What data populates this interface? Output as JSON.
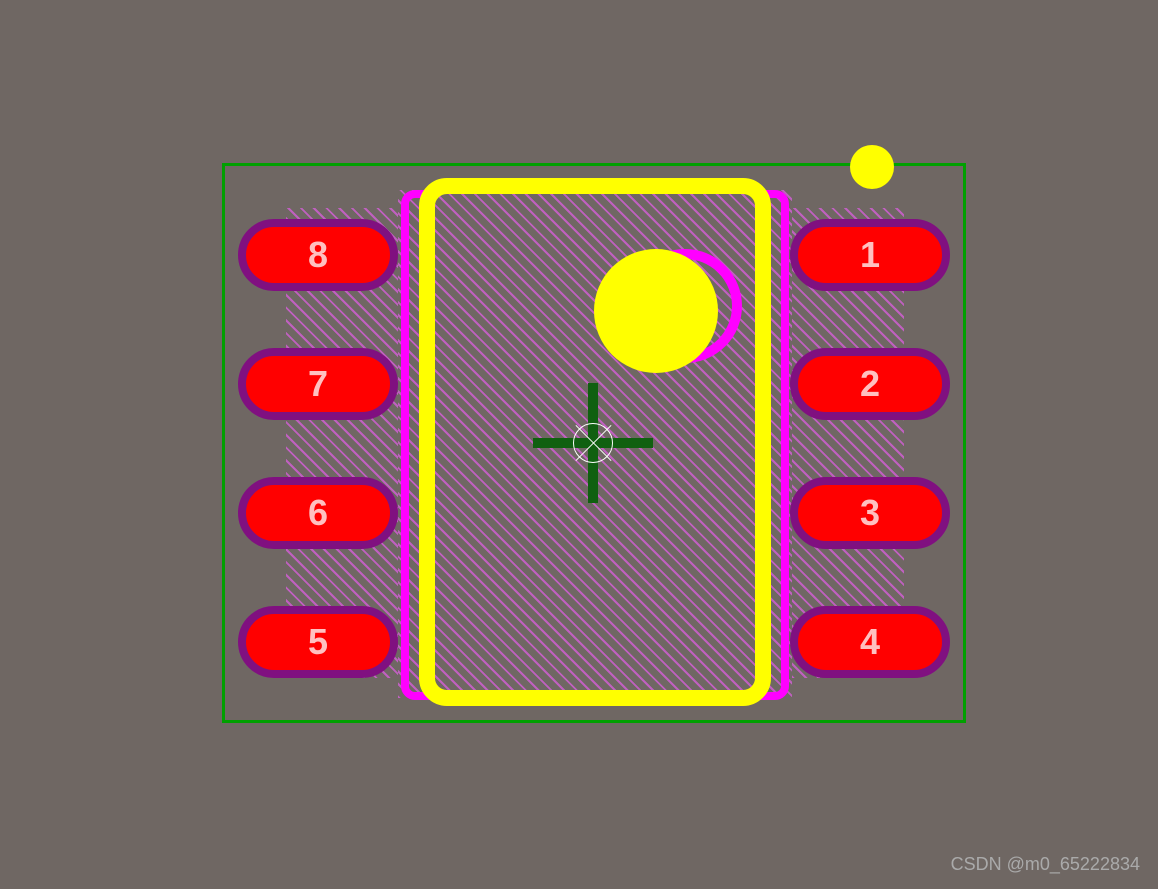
{
  "colors": {
    "background": "#6f6763",
    "courtyard": "#00a000",
    "silkscreen_yellow": "#ffff00",
    "fab_magenta": "#ff00ff",
    "pad_copper": "#ff0000",
    "pad_mask": "#801080",
    "hatch": "#c060c0",
    "origin_cross": "#106010",
    "origin_marker": "#ffffff"
  },
  "pads": {
    "right": [
      {
        "number": "1"
      },
      {
        "number": "2"
      },
      {
        "number": "3"
      },
      {
        "number": "4"
      }
    ],
    "left": [
      {
        "number": "8"
      },
      {
        "number": "7"
      },
      {
        "number": "6"
      },
      {
        "number": "5"
      }
    ]
  },
  "watermark": "CSDN @m0_65222834"
}
